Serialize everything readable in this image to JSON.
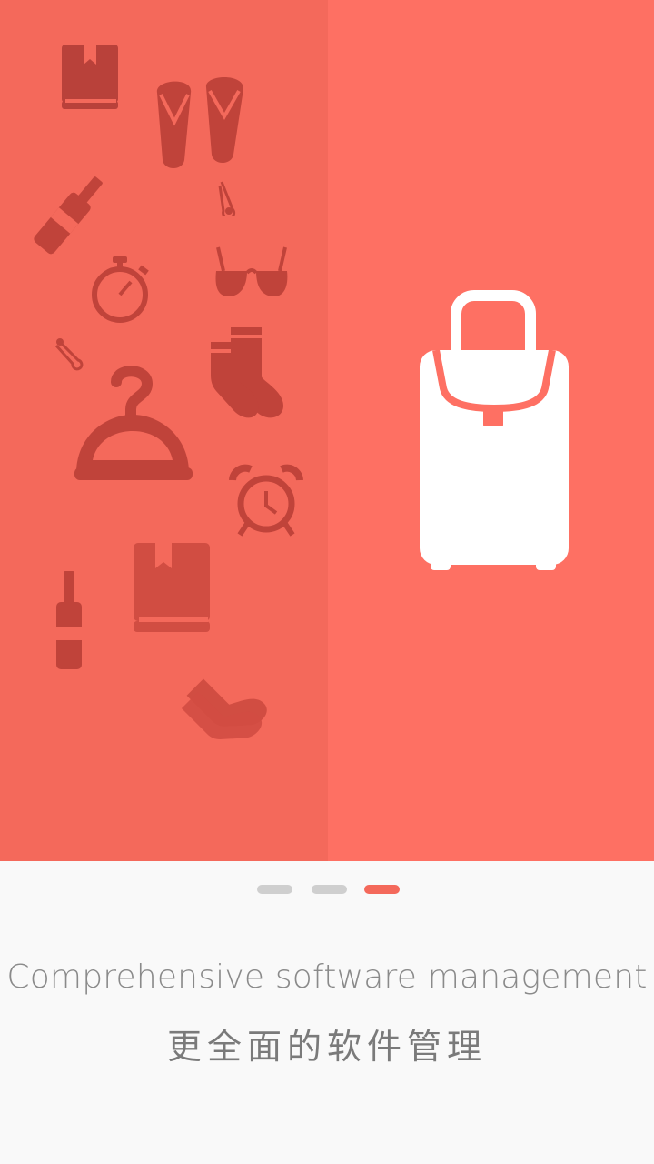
{
  "hero": {
    "icons": [
      "book-icon",
      "flip-flops-icon",
      "safety-pin-icon",
      "bottle-icon",
      "sunglasses-icon",
      "stopwatch-icon",
      "safety-pin-icon",
      "socks-icon",
      "hanger-icon",
      "alarm-clock-icon",
      "book-icon",
      "bottle-icon",
      "socks-icon"
    ],
    "main_icon": "suitcase-icon",
    "colors": {
      "background": "#fe7063",
      "left_panel": "#f4695b",
      "icon_fill": "#c0433a"
    }
  },
  "pager": {
    "total": 3,
    "current": 3
  },
  "text": {
    "title_en": "Comprehensive software management",
    "title_zh": "更全面的软件管理"
  }
}
